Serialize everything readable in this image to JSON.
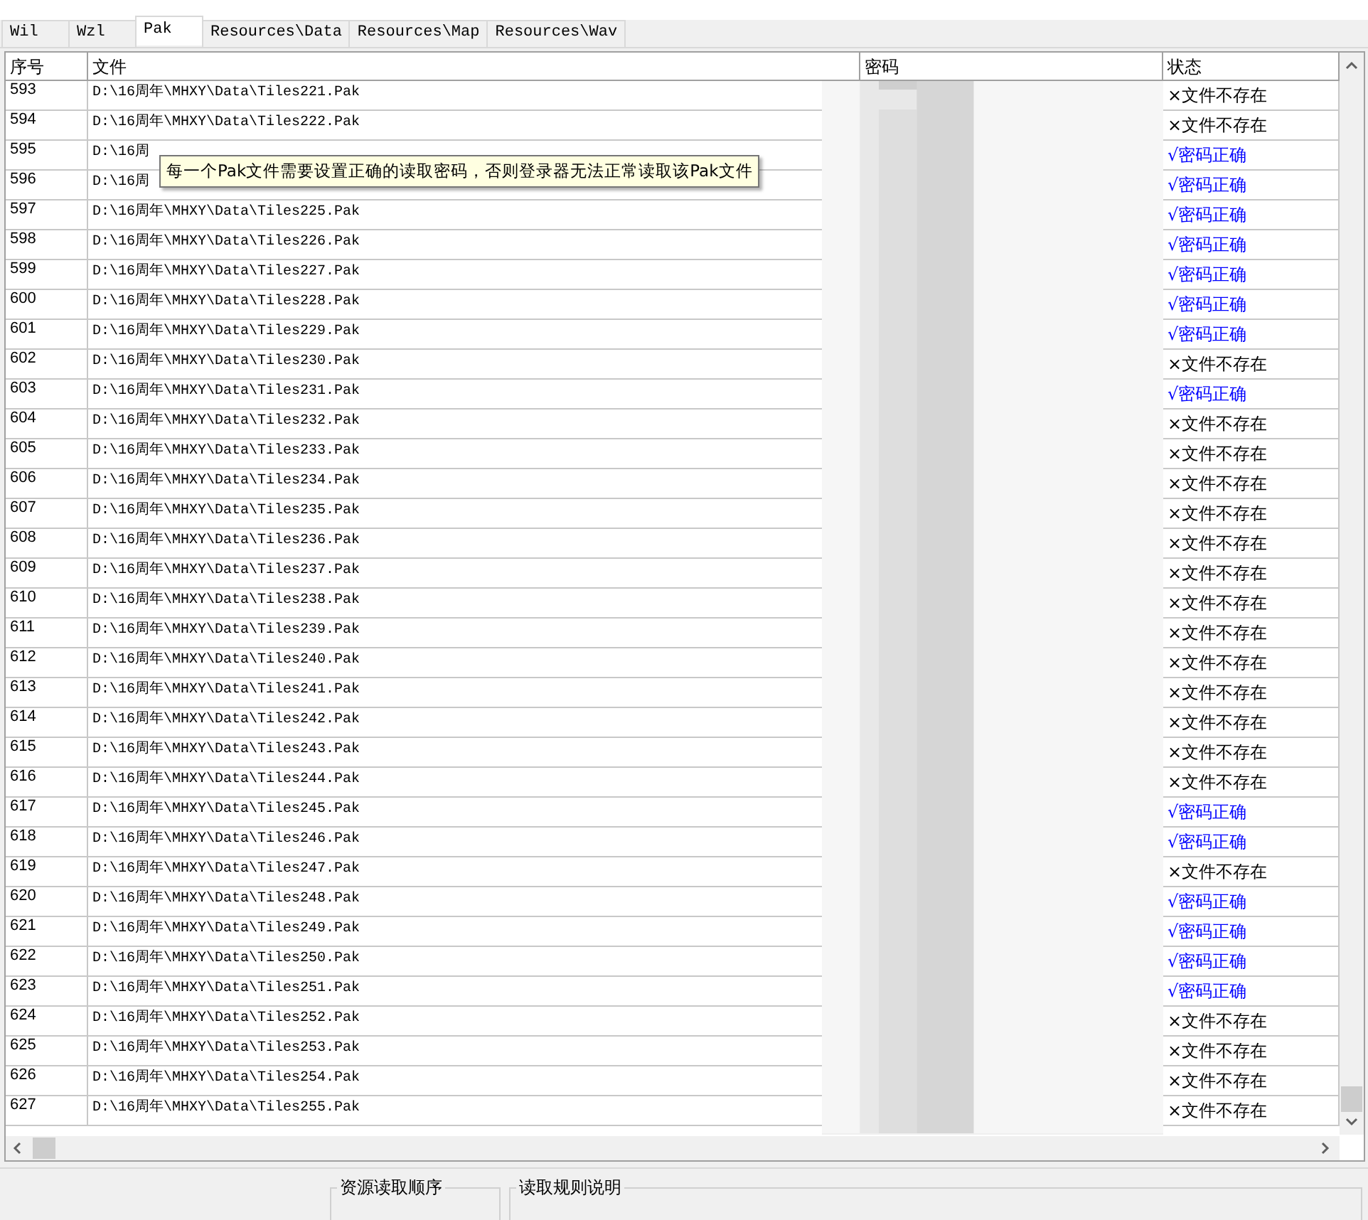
{
  "tabs": [
    {
      "label": "Wil",
      "selected": false
    },
    {
      "label": "Wzl",
      "selected": false
    },
    {
      "label": "Pak",
      "selected": true
    },
    {
      "label": "Resources\\Data",
      "selected": false
    },
    {
      "label": "Resources\\Map",
      "selected": false
    },
    {
      "label": "Resources\\Wav",
      "selected": false
    }
  ],
  "table": {
    "columns": [
      "序号",
      "文件",
      "密码",
      "状态"
    ],
    "rows": [
      {
        "index": "593",
        "file": "D:\\16周年\\MHXY\\Data\\Tiles221.Pak",
        "status": "×文件不存在",
        "valid": false
      },
      {
        "index": "594",
        "file": "D:\\16周年\\MHXY\\Data\\Tiles222.Pak",
        "status": "×文件不存在",
        "valid": false
      },
      {
        "index": "595",
        "file": "D:\\16周",
        "status": "√密码正确",
        "valid": true
      },
      {
        "index": "596",
        "file": "D:\\16周",
        "status": "√密码正确",
        "valid": true
      },
      {
        "index": "597",
        "file": "D:\\16周年\\MHXY\\Data\\Tiles225.Pak",
        "status": "√密码正确",
        "valid": true
      },
      {
        "index": "598",
        "file": "D:\\16周年\\MHXY\\Data\\Tiles226.Pak",
        "status": "√密码正确",
        "valid": true
      },
      {
        "index": "599",
        "file": "D:\\16周年\\MHXY\\Data\\Tiles227.Pak",
        "status": "√密码正确",
        "valid": true
      },
      {
        "index": "600",
        "file": "D:\\16周年\\MHXY\\Data\\Tiles228.Pak",
        "status": "√密码正确",
        "valid": true
      },
      {
        "index": "601",
        "file": "D:\\16周年\\MHXY\\Data\\Tiles229.Pak",
        "status": "√密码正确",
        "valid": true
      },
      {
        "index": "602",
        "file": "D:\\16周年\\MHXY\\Data\\Tiles230.Pak",
        "status": "×文件不存在",
        "valid": false
      },
      {
        "index": "603",
        "file": "D:\\16周年\\MHXY\\Data\\Tiles231.Pak",
        "status": "√密码正确",
        "valid": true
      },
      {
        "index": "604",
        "file": "D:\\16周年\\MHXY\\Data\\Tiles232.Pak",
        "status": "×文件不存在",
        "valid": false
      },
      {
        "index": "605",
        "file": "D:\\16周年\\MHXY\\Data\\Tiles233.Pak",
        "status": "×文件不存在",
        "valid": false
      },
      {
        "index": "606",
        "file": "D:\\16周年\\MHXY\\Data\\Tiles234.Pak",
        "status": "×文件不存在",
        "valid": false
      },
      {
        "index": "607",
        "file": "D:\\16周年\\MHXY\\Data\\Tiles235.Pak",
        "status": "×文件不存在",
        "valid": false
      },
      {
        "index": "608",
        "file": "D:\\16周年\\MHXY\\Data\\Tiles236.Pak",
        "status": "×文件不存在",
        "valid": false
      },
      {
        "index": "609",
        "file": "D:\\16周年\\MHXY\\Data\\Tiles237.Pak",
        "status": "×文件不存在",
        "valid": false
      },
      {
        "index": "610",
        "file": "D:\\16周年\\MHXY\\Data\\Tiles238.Pak",
        "status": "×文件不存在",
        "valid": false
      },
      {
        "index": "611",
        "file": "D:\\16周年\\MHXY\\Data\\Tiles239.Pak",
        "status": "×文件不存在",
        "valid": false
      },
      {
        "index": "612",
        "file": "D:\\16周年\\MHXY\\Data\\Tiles240.Pak",
        "status": "×文件不存在",
        "valid": false
      },
      {
        "index": "613",
        "file": "D:\\16周年\\MHXY\\Data\\Tiles241.Pak",
        "status": "×文件不存在",
        "valid": false
      },
      {
        "index": "614",
        "file": "D:\\16周年\\MHXY\\Data\\Tiles242.Pak",
        "status": "×文件不存在",
        "valid": false
      },
      {
        "index": "615",
        "file": "D:\\16周年\\MHXY\\Data\\Tiles243.Pak",
        "status": "×文件不存在",
        "valid": false
      },
      {
        "index": "616",
        "file": "D:\\16周年\\MHXY\\Data\\Tiles244.Pak",
        "status": "×文件不存在",
        "valid": false
      },
      {
        "index": "617",
        "file": "D:\\16周年\\MHXY\\Data\\Tiles245.Pak",
        "status": "√密码正确",
        "valid": true
      },
      {
        "index": "618",
        "file": "D:\\16周年\\MHXY\\Data\\Tiles246.Pak",
        "status": "√密码正确",
        "valid": true
      },
      {
        "index": "619",
        "file": "D:\\16周年\\MHXY\\Data\\Tiles247.Pak",
        "status": "×文件不存在",
        "valid": false
      },
      {
        "index": "620",
        "file": "D:\\16周年\\MHXY\\Data\\Tiles248.Pak",
        "status": "√密码正确",
        "valid": true
      },
      {
        "index": "621",
        "file": "D:\\16周年\\MHXY\\Data\\Tiles249.Pak",
        "status": "√密码正确",
        "valid": true
      },
      {
        "index": "622",
        "file": "D:\\16周年\\MHXY\\Data\\Tiles250.Pak",
        "status": "√密码正确",
        "valid": true
      },
      {
        "index": "623",
        "file": "D:\\16周年\\MHXY\\Data\\Tiles251.Pak",
        "status": "√密码正确",
        "valid": true
      },
      {
        "index": "624",
        "file": "D:\\16周年\\MHXY\\Data\\Tiles252.Pak",
        "status": "×文件不存在",
        "valid": false
      },
      {
        "index": "625",
        "file": "D:\\16周年\\MHXY\\Data\\Tiles253.Pak",
        "status": "×文件不存在",
        "valid": false
      },
      {
        "index": "626",
        "file": "D:\\16周年\\MHXY\\Data\\Tiles254.Pak",
        "status": "×文件不存在",
        "valid": false
      },
      {
        "index": "627",
        "file": "D:\\16周年\\MHXY\\Data\\Tiles255.Pak",
        "status": "×文件不存在",
        "valid": false
      }
    ]
  },
  "tooltip": "每一个Pak文件需要设置正确的读取密码，否则登录器无法正常读取该Pak文件",
  "groups": [
    {
      "title": "资源读取顺序"
    },
    {
      "title": "读取规则说明"
    }
  ]
}
